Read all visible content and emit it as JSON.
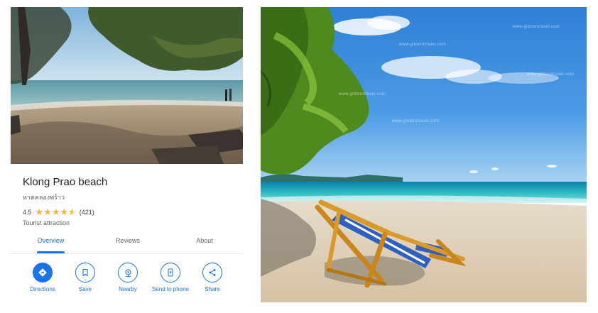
{
  "place": {
    "name": "Klong Prao beach",
    "local_name": "หาดคลองพร้าว",
    "rating": "4.5",
    "review_count": "(421)",
    "category": "Tourist attraction"
  },
  "tabs": [
    {
      "label": "Overview",
      "active": true
    },
    {
      "label": "Reviews",
      "active": false
    },
    {
      "label": "About",
      "active": false
    }
  ],
  "actions": [
    {
      "label": "Directions",
      "icon": "directions-icon"
    },
    {
      "label": "Save",
      "icon": "bookmark-icon"
    },
    {
      "label": "Nearby",
      "icon": "nearby-icon"
    },
    {
      "label": "Send to phone",
      "icon": "phone-icon"
    },
    {
      "label": "Share",
      "icon": "share-icon"
    }
  ],
  "watermark": "www.gibbontravel.com",
  "colors": {
    "accent": "#1a73e8",
    "star": "#fbbc04",
    "text": "#202124",
    "muted": "#5f6368"
  }
}
